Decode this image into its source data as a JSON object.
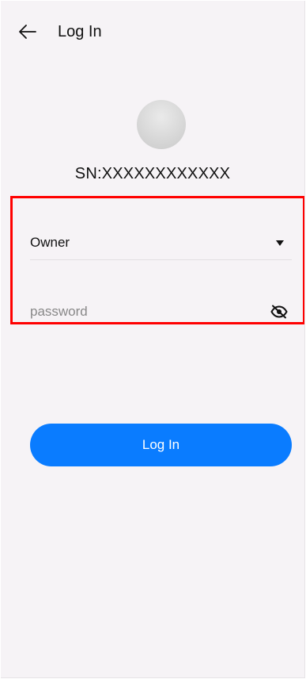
{
  "header": {
    "title": "Log In",
    "back_icon": "arrow-left-icon"
  },
  "device": {
    "sn": "SN:XXXXXXXXXXXX"
  },
  "form": {
    "role": {
      "selected": "Owner",
      "icon": "dropdown-triangle-icon"
    },
    "password": {
      "placeholder": "password",
      "value": "",
      "toggle_icon": "eye-off-icon"
    }
  },
  "actions": {
    "login_label": "Log In"
  },
  "colors": {
    "background": "#f6f3f6",
    "accent": "#0a7cff",
    "highlight": "#ff0000"
  }
}
